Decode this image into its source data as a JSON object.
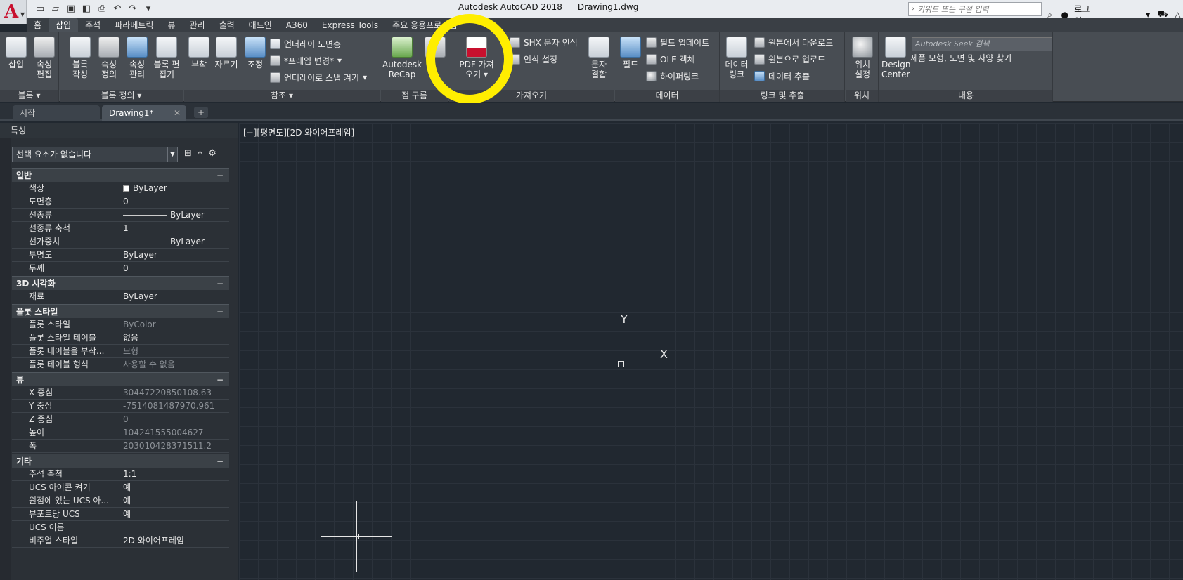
{
  "app": {
    "title": "Autodesk AutoCAD 2018",
    "document": "Drawing1.dwg",
    "search_placeholder": "키워드 또는 구절 입력",
    "login": "로그인"
  },
  "ribbon_tabs": [
    "홈",
    "삽입",
    "주석",
    "파라메트릭",
    "뷰",
    "관리",
    "출력",
    "애드인",
    "A360",
    "Express Tools",
    "주요 응용프로그램"
  ],
  "ribbon": {
    "block": {
      "insert": "삽입",
      "edit_attr": "속성 편집",
      "title": "블록"
    },
    "block_def": {
      "create": "블록 작성",
      "define_attr": "속성 정의",
      "manage_attr": "속성 관리",
      "block_editor": "블록 편집기",
      "title": "블록 정의"
    },
    "reference": {
      "attach": "부착",
      "clip": "자르기",
      "adjust": "조정",
      "underlay_layers": "언더레이 도면층",
      "frame_change": "*프레임 변경*",
      "snap_underlay": "언더레이로 스냅 켜기",
      "title": "참조"
    },
    "point_cloud": {
      "recap": "Autodesk ReCap",
      "title": "점 구름"
    },
    "import": {
      "pdf_import": "PDF 가져오기",
      "pdf_label": "PDF",
      "shx_recognize": "SHX 문자 인식",
      "recognize_settings": "인식 설정",
      "combine_text": "문자 결합",
      "title": "가져오기"
    },
    "data": {
      "field": "필드",
      "update_fields": "필드 업데이트",
      "ole_object": "OLE 객체",
      "hyperlink": "하이퍼링크",
      "title": "데이터"
    },
    "linking": {
      "data_link": "데이터 링크",
      "download_source": "원본에서 다운로드",
      "upload_source": "원본으로 업로드",
      "extract_data": "데이터 추출",
      "title": "링크 및 추출"
    },
    "location": {
      "set_location": "위치 설정",
      "title": "위치"
    },
    "content": {
      "design_center": "Design Center",
      "seek_placeholder": "Autodesk Seek 검색",
      "seek_desc": "제품 모형, 도면 및 사양 찾기",
      "title": "내용"
    }
  },
  "doc_tabs": {
    "start": "시작",
    "drawing": "Drawing1*"
  },
  "properties": {
    "title": "특성",
    "selection": "선택 요소가 없습니다",
    "sections": [
      {
        "name": "일반",
        "rows": [
          {
            "k": "색상",
            "v": "ByLayer",
            "type": "swatch"
          },
          {
            "k": "도면층",
            "v": "0"
          },
          {
            "k": "선종류",
            "v": "ByLayer",
            "type": "line"
          },
          {
            "k": "선종류 축척",
            "v": "1"
          },
          {
            "k": "선가중치",
            "v": "ByLayer",
            "type": "line"
          },
          {
            "k": "투명도",
            "v": "ByLayer"
          },
          {
            "k": "두께",
            "v": "0"
          }
        ]
      },
      {
        "name": "3D 시각화",
        "rows": [
          {
            "k": "재료",
            "v": "ByLayer"
          }
        ]
      },
      {
        "name": "플롯 스타일",
        "rows": [
          {
            "k": "플롯 스타일",
            "v": "ByColor",
            "dim": true
          },
          {
            "k": "플롯 스타일 테이블",
            "v": "없음"
          },
          {
            "k": "플롯 테이블을 부착...",
            "v": "모형",
            "dim": true
          },
          {
            "k": "플롯 테이블 형식",
            "v": "사용할 수 없음",
            "dim": true
          }
        ]
      },
      {
        "name": "뷰",
        "rows": [
          {
            "k": "X 중심",
            "v": "30447220850108.63",
            "dim": true
          },
          {
            "k": "Y 중심",
            "v": "-7514081487970.961",
            "dim": true
          },
          {
            "k": "Z 중심",
            "v": "0",
            "dim": true
          },
          {
            "k": "높이",
            "v": "104241555004627",
            "dim": true
          },
          {
            "k": "폭",
            "v": "203010428371511.2",
            "dim": true
          }
        ]
      },
      {
        "name": "기타",
        "rows": [
          {
            "k": "주석 축척",
            "v": "1:1"
          },
          {
            "k": "UCS 아이콘 켜기",
            "v": "예"
          },
          {
            "k": "원점에 있는 UCS 아...",
            "v": "예"
          },
          {
            "k": "뷰포트당 UCS",
            "v": "예"
          },
          {
            "k": "UCS 이름",
            "v": ""
          },
          {
            "k": "비주얼 스타일",
            "v": "2D 와이어프레임"
          }
        ]
      }
    ]
  },
  "viewport": {
    "label": "[−][평면도][2D 와이어프레임]",
    "axis_y": "Y",
    "axis_x": "X"
  },
  "colors": {
    "highlight": "#ffee00",
    "canvas_bg": "#212830",
    "ribbon_bg": "#484d53"
  }
}
